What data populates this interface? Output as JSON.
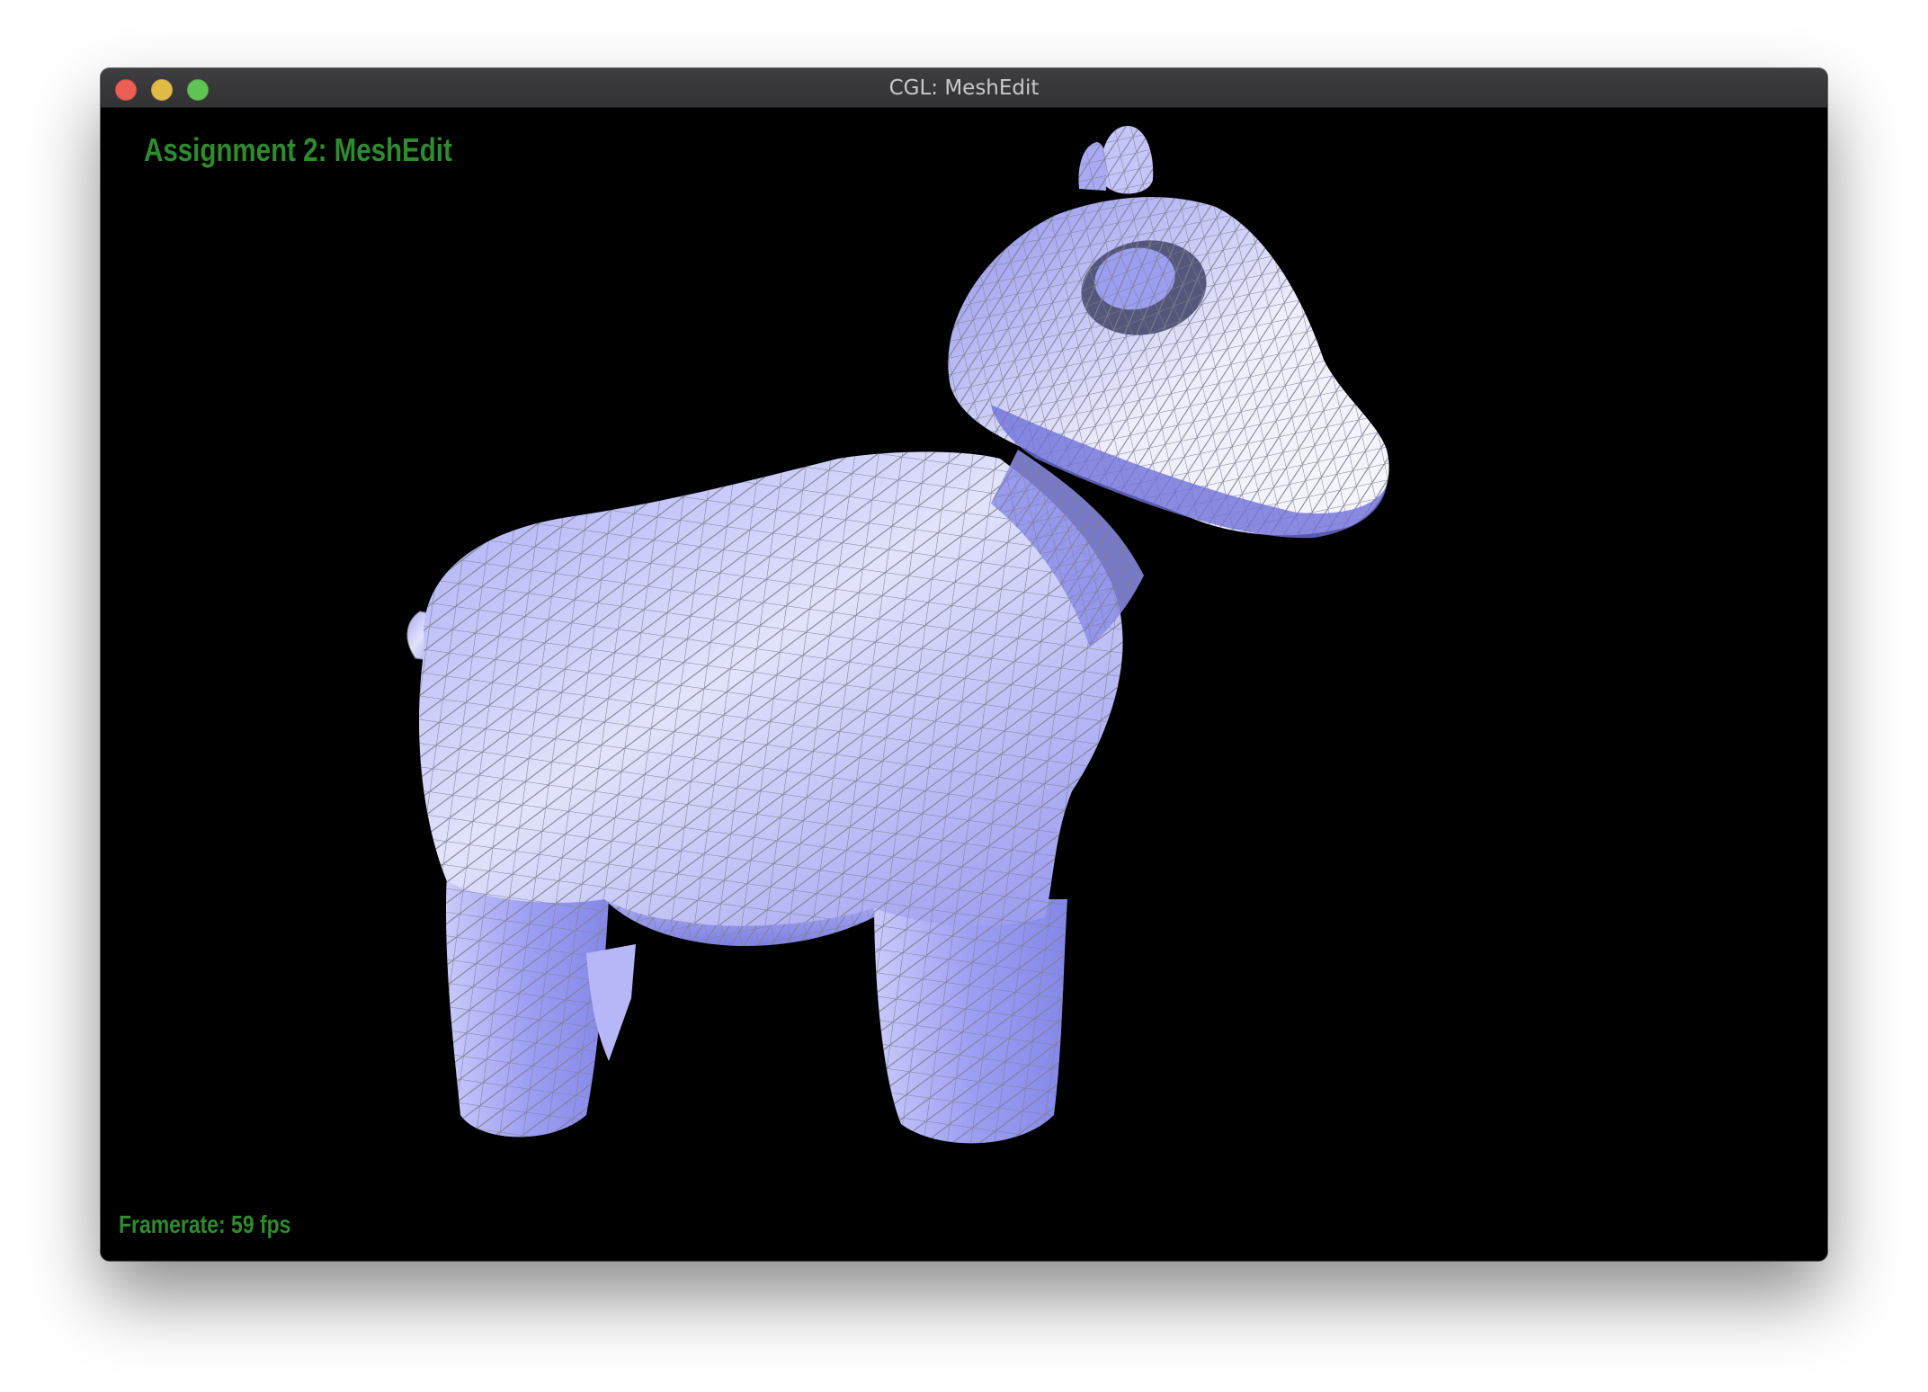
{
  "window": {
    "title": "CGL: MeshEdit"
  },
  "viewport": {
    "heading": "Assignment 2: MeshEdit",
    "framerate": "Framerate: 59 fps",
    "model": "cow mesh (wireframe + shaded)",
    "mesh_color": "#9a9cf5",
    "wire_color": "#8e8e9e",
    "text_color": "#2e8b2e"
  },
  "icons": {
    "close": "close-window-icon",
    "minimize": "minimize-window-icon",
    "maximize": "maximize-window-icon"
  }
}
